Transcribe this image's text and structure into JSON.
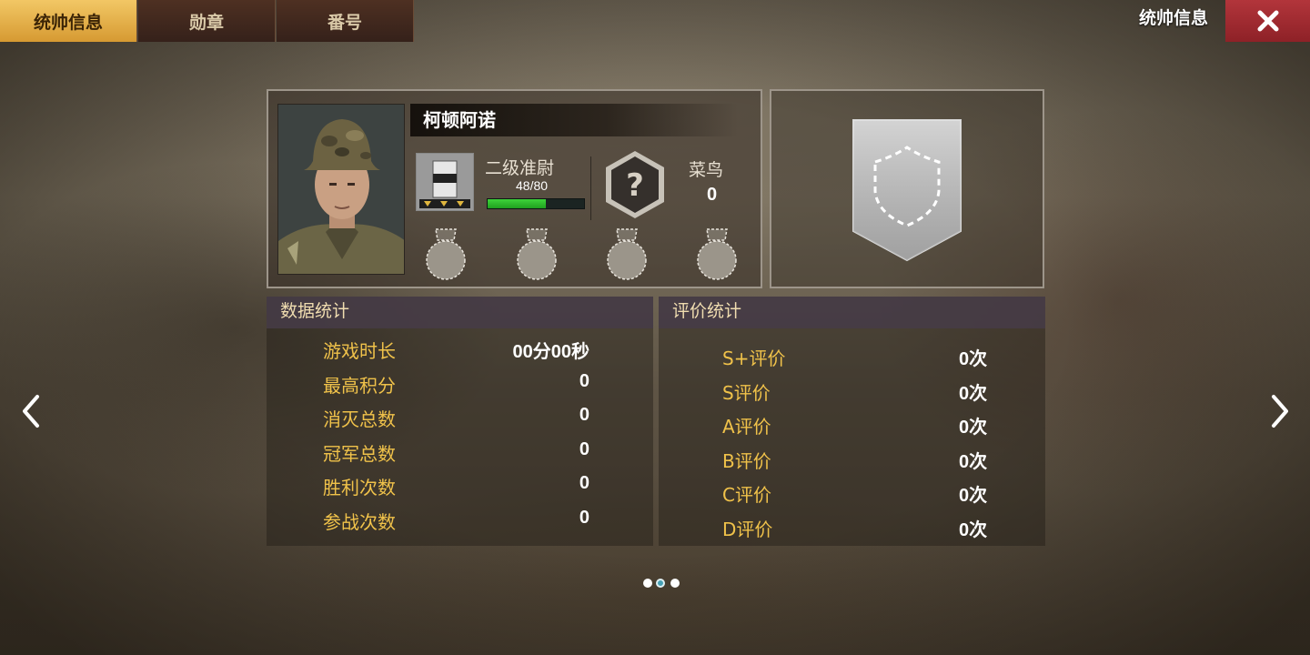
{
  "tabs": [
    {
      "label": "统帅信息",
      "active": true
    },
    {
      "label": "勋章",
      "active": false
    },
    {
      "label": "番号",
      "active": false
    }
  ],
  "header": {
    "title": "统帅信息",
    "close_icon": "close-x-icon"
  },
  "profile": {
    "name": "柯顿阿诺",
    "rank_name": "二级准尉",
    "xp_current": 48,
    "xp_max": 80,
    "xp_text": "48/80",
    "tier_name": "菜鸟",
    "tier_score": "0",
    "tier_icon": "question-hexagon-icon",
    "medal_slots": 4
  },
  "emblem": {
    "icon": "empty-shield-icon"
  },
  "data_stats": {
    "title": "数据统计",
    "rows": [
      {
        "label": "游戏时长",
        "value": "00分00秒"
      },
      {
        "label": "最高积分",
        "value": "0"
      },
      {
        "label": "消灭总数",
        "value": "0"
      },
      {
        "label": "冠军总数",
        "value": "0"
      },
      {
        "label": "胜利次数",
        "value": "0"
      },
      {
        "label": "参战次数",
        "value": "0"
      }
    ]
  },
  "rating_stats": {
    "title": "评价统计",
    "rows": [
      {
        "label": "S+评价",
        "value": "0次"
      },
      {
        "label": "S评价",
        "value": "0次"
      },
      {
        "label": "A评价",
        "value": "0次"
      },
      {
        "label": "B评价",
        "value": "0次"
      },
      {
        "label": "C评价",
        "value": "0次"
      },
      {
        "label": "D评价",
        "value": "0次"
      }
    ]
  },
  "pagination": {
    "pages": 3,
    "current": 2
  },
  "colors": {
    "accent_gold": "#f0c24a",
    "tab_active": "#e3ad4a",
    "close_red": "#a12b31",
    "xp_green": "#2fc02c"
  }
}
